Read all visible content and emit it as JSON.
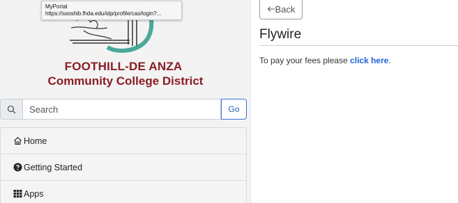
{
  "tooltip": {
    "title": "MyPortal",
    "url": "https://ssoshib.fhda.edu/idp/profile/cas/login?..."
  },
  "sidebar": {
    "logo": {
      "line1": "FOOTHILL-DE ANZA",
      "line2": "Community College District",
      "accent_color": "#8b1c24",
      "art_color": "#4aa89a"
    },
    "search": {
      "placeholder": "Search",
      "go_label": "Go"
    },
    "nav": [
      {
        "label": "Home",
        "icon": "home-icon"
      },
      {
        "label": "Getting Started",
        "icon": "question-circle-icon"
      },
      {
        "label": "Apps",
        "icon": "grid-icon"
      }
    ]
  },
  "main": {
    "back_label": "Back",
    "title": "Flywire",
    "body_prefix": "To pay your fees please ",
    "link_label": "click here",
    "body_suffix": ".",
    "link_color": "#1f62d6"
  }
}
